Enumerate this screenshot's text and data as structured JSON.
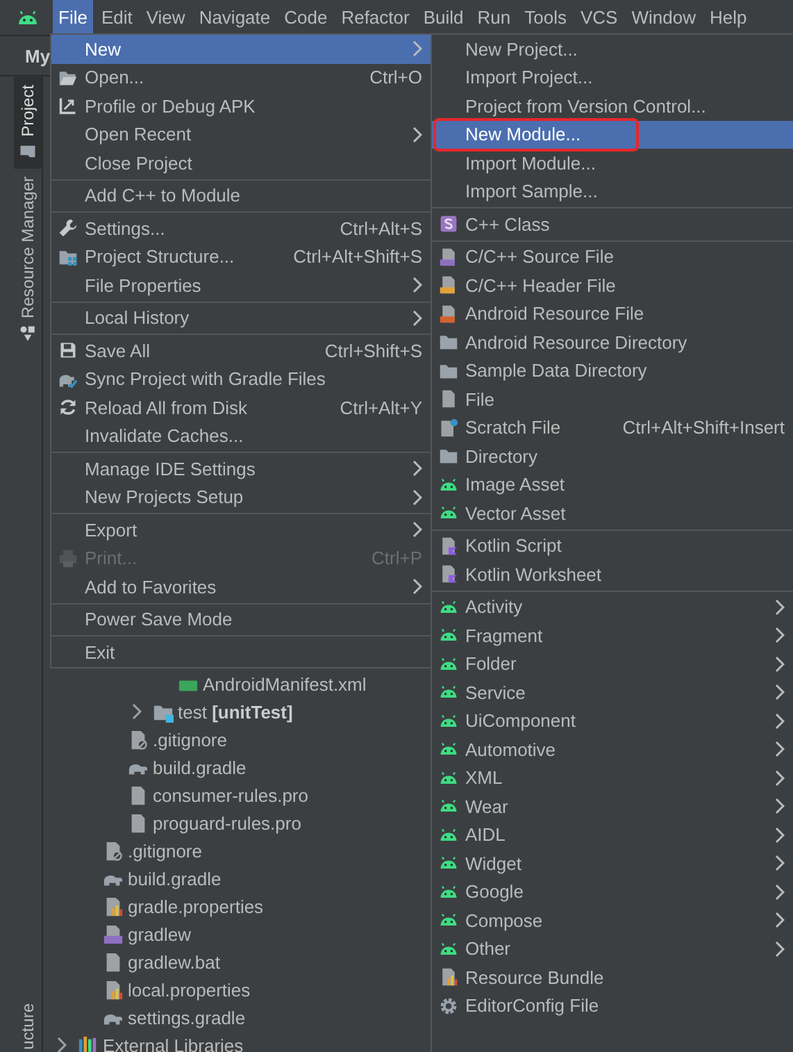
{
  "menu_bar": {
    "items": [
      {
        "label": "File",
        "selected": true
      },
      {
        "label": "Edit",
        "selected": false
      },
      {
        "label": "View",
        "selected": false
      },
      {
        "label": "Navigate",
        "selected": false
      },
      {
        "label": "Code",
        "selected": false
      },
      {
        "label": "Refactor",
        "selected": false
      },
      {
        "label": "Build",
        "selected": false
      },
      {
        "label": "Run",
        "selected": false
      },
      {
        "label": "Tools",
        "selected": false
      },
      {
        "label": "VCS",
        "selected": false
      },
      {
        "label": "Window",
        "selected": false
      },
      {
        "label": "Help",
        "selected": false
      }
    ]
  },
  "panel_title": "My",
  "tool_strip": {
    "tabs": [
      {
        "label": "Project",
        "kind": "folder",
        "selected": true
      },
      {
        "label": "Resource Manager",
        "kind": "resources",
        "selected": false
      }
    ],
    "bottom_tab": {
      "label": "ucture"
    }
  },
  "project_tree": [
    {
      "children": [
        {
          "children": [
            {
              "children": [
                {
                  "children": [
                    {
                      "label": "AndroidManifest.xml",
                      "kind": "manifest"
                    }
                  ]
                },
                {
                  "label": "test **[unitTest]**",
                  "kind": "test-folder",
                  "expanded": false
                }
              ]
            },
            {
              "label": ".gitignore",
              "kind": "gitignore"
            },
            {
              "label": "build.gradle",
              "kind": "gradle"
            },
            {
              "label": "consumer-rules.pro",
              "kind": "file"
            },
            {
              "label": "proguard-rules.pro",
              "kind": "file"
            }
          ]
        },
        {
          "label": ".gitignore",
          "kind": "gitignore"
        },
        {
          "label": "build.gradle",
          "kind": "gradle"
        },
        {
          "label": "gradle.properties",
          "kind": "properties"
        },
        {
          "label": "gradlew",
          "kind": "gradlew"
        },
        {
          "label": "gradlew.bat",
          "kind": "file"
        },
        {
          "label": "local.properties",
          "kind": "properties"
        },
        {
          "label": "settings.gradle",
          "kind": "gradle"
        }
      ]
    },
    {
      "label": "External Libraries",
      "kind": "libraries",
      "expanded": false
    }
  ],
  "file_menu": {
    "groups": [
      [
        {
          "label": "New",
          "submenu": true,
          "selected": true,
          "disabled": false
        },
        {
          "label": "Open...",
          "shortcut": "Ctrl+O",
          "kind": "open",
          "submenu": false,
          "selected": false,
          "disabled": false
        },
        {
          "label": "Profile or Debug APK",
          "kind": "profile",
          "submenu": false,
          "selected": false,
          "disabled": false
        },
        {
          "label": "Open Recent",
          "submenu": true,
          "selected": false,
          "disabled": false
        },
        {
          "label": "Close Project",
          "submenu": false,
          "selected": false,
          "disabled": false
        }
      ],
      [
        {
          "label": "Add C++ to Module",
          "submenu": false,
          "selected": false,
          "disabled": false
        }
      ],
      [
        {
          "label": "Settings...",
          "shortcut": "Ctrl+Alt+S",
          "kind": "settings",
          "submenu": false,
          "selected": false,
          "disabled": false
        },
        {
          "label": "Project Structure...",
          "shortcut": "Ctrl+Alt+Shift+S",
          "kind": "structure",
          "submenu": false,
          "selected": false,
          "disabled": false
        },
        {
          "label": "File Properties",
          "submenu": true,
          "selected": false,
          "disabled": false
        }
      ],
      [
        {
          "label": "Local History",
          "submenu": true,
          "selected": false,
          "disabled": false
        }
      ],
      [
        {
          "label": "Save All",
          "shortcut": "Ctrl+Shift+S",
          "kind": "save",
          "submenu": false,
          "selected": false,
          "disabled": false
        },
        {
          "label": "Sync Project with Gradle Files",
          "kind": "sync",
          "submenu": false,
          "selected": false,
          "disabled": false
        },
        {
          "label": "Reload All from Disk",
          "shortcut": "Ctrl+Alt+Y",
          "kind": "reload",
          "submenu": false,
          "selected": false,
          "disabled": false
        },
        {
          "label": "Invalidate Caches...",
          "submenu": false,
          "selected": false,
          "disabled": false
        }
      ],
      [
        {
          "label": "Manage IDE Settings",
          "submenu": true,
          "selected": false,
          "disabled": false
        },
        {
          "label": "New Projects Setup",
          "submenu": true,
          "selected": false,
          "disabled": false
        }
      ],
      [
        {
          "label": "Export",
          "submenu": true,
          "selected": false,
          "disabled": false
        },
        {
          "label": "Print...",
          "shortcut": "Ctrl+P",
          "kind": "print",
          "submenu": false,
          "selected": false,
          "disabled": true
        },
        {
          "label": "Add to Favorites",
          "submenu": true,
          "selected": false,
          "disabled": false
        }
      ],
      [
        {
          "label": "Power Save Mode",
          "submenu": false,
          "selected": false,
          "disabled": false
        }
      ],
      [
        {
          "label": "Exit",
          "submenu": false,
          "selected": false,
          "disabled": false
        }
      ]
    ]
  },
  "new_submenu": {
    "groups": [
      [
        {
          "label": "New Project...",
          "submenu": false,
          "selected": false,
          "outlined": false
        },
        {
          "label": "Import Project...",
          "submenu": false,
          "selected": false,
          "outlined": false
        },
        {
          "label": "Project from Version Control...",
          "submenu": false,
          "selected": false,
          "outlined": false
        },
        {
          "label": "New Module...",
          "submenu": false,
          "selected": true,
          "outlined": true
        },
        {
          "label": "Import Module...",
          "submenu": false,
          "selected": false,
          "outlined": false
        },
        {
          "label": "Import Sample...",
          "submenu": false,
          "selected": false,
          "outlined": false
        }
      ],
      [
        {
          "label": "C++ Class",
          "kind": "cpp-class",
          "submenu": false,
          "selected": false,
          "outlined": false
        }
      ],
      [
        {
          "label": "C/C++ Source File",
          "kind": "cpp-source",
          "submenu": false,
          "selected": false,
          "outlined": false
        },
        {
          "label": "C/C++ Header File",
          "kind": "cpp-header",
          "submenu": false,
          "selected": false,
          "outlined": false
        },
        {
          "label": "Android Resource File",
          "kind": "res-file",
          "submenu": false,
          "selected": false,
          "outlined": false
        },
        {
          "label": "Android Resource Directory",
          "kind": "folder",
          "submenu": false,
          "selected": false,
          "outlined": false
        },
        {
          "label": "Sample Data Directory",
          "kind": "folder",
          "submenu": false,
          "selected": false,
          "outlined": false
        },
        {
          "label": "File",
          "kind": "file",
          "submenu": false,
          "selected": false,
          "outlined": false
        },
        {
          "label": "Scratch File",
          "shortcut": "Ctrl+Alt+Shift+Insert",
          "kind": "scratch",
          "submenu": false,
          "selected": false,
          "outlined": false
        },
        {
          "label": "Directory",
          "kind": "folder",
          "submenu": false,
          "selected": false,
          "outlined": false
        },
        {
          "label": "Image Asset",
          "kind": "android",
          "submenu": false,
          "selected": false,
          "outlined": false
        },
        {
          "label": "Vector Asset",
          "kind": "android",
          "submenu": false,
          "selected": false,
          "outlined": false
        }
      ],
      [
        {
          "label": "Kotlin Script",
          "kind": "kotlin",
          "submenu": false,
          "selected": false,
          "outlined": false
        },
        {
          "label": "Kotlin Worksheet",
          "kind": "kotlin",
          "submenu": false,
          "selected": false,
          "outlined": false
        }
      ],
      [
        {
          "label": "Activity",
          "kind": "android",
          "submenu": true,
          "selected": false,
          "outlined": false
        },
        {
          "label": "Fragment",
          "kind": "android",
          "submenu": true,
          "selected": false,
          "outlined": false
        },
        {
          "label": "Folder",
          "kind": "android",
          "submenu": true,
          "selected": false,
          "outlined": false
        },
        {
          "label": "Service",
          "kind": "android",
          "submenu": true,
          "selected": false,
          "outlined": false
        },
        {
          "label": "UiComponent",
          "kind": "android",
          "submenu": true,
          "selected": false,
          "outlined": false
        },
        {
          "label": "Automotive",
          "kind": "android",
          "submenu": true,
          "selected": false,
          "outlined": false
        },
        {
          "label": "XML",
          "kind": "android",
          "submenu": true,
          "selected": false,
          "outlined": false
        },
        {
          "label": "Wear",
          "kind": "android",
          "submenu": true,
          "selected": false,
          "outlined": false
        },
        {
          "label": "AIDL",
          "kind": "android",
          "submenu": true,
          "selected": false,
          "outlined": false
        },
        {
          "label": "Widget",
          "kind": "android",
          "submenu": true,
          "selected": false,
          "outlined": false
        },
        {
          "label": "Google",
          "kind": "android",
          "submenu": true,
          "selected": false,
          "outlined": false
        },
        {
          "label": "Compose",
          "kind": "android",
          "submenu": true,
          "selected": false,
          "outlined": false
        },
        {
          "label": "Other",
          "kind": "android",
          "submenu": true,
          "selected": false,
          "outlined": false
        },
        {
          "label": "Resource Bundle",
          "kind": "properties",
          "submenu": false,
          "selected": false,
          "outlined": false
        },
        {
          "label": "EditorConfig File",
          "kind": "gear",
          "submenu": false,
          "selected": false,
          "outlined": false
        }
      ]
    ]
  }
}
